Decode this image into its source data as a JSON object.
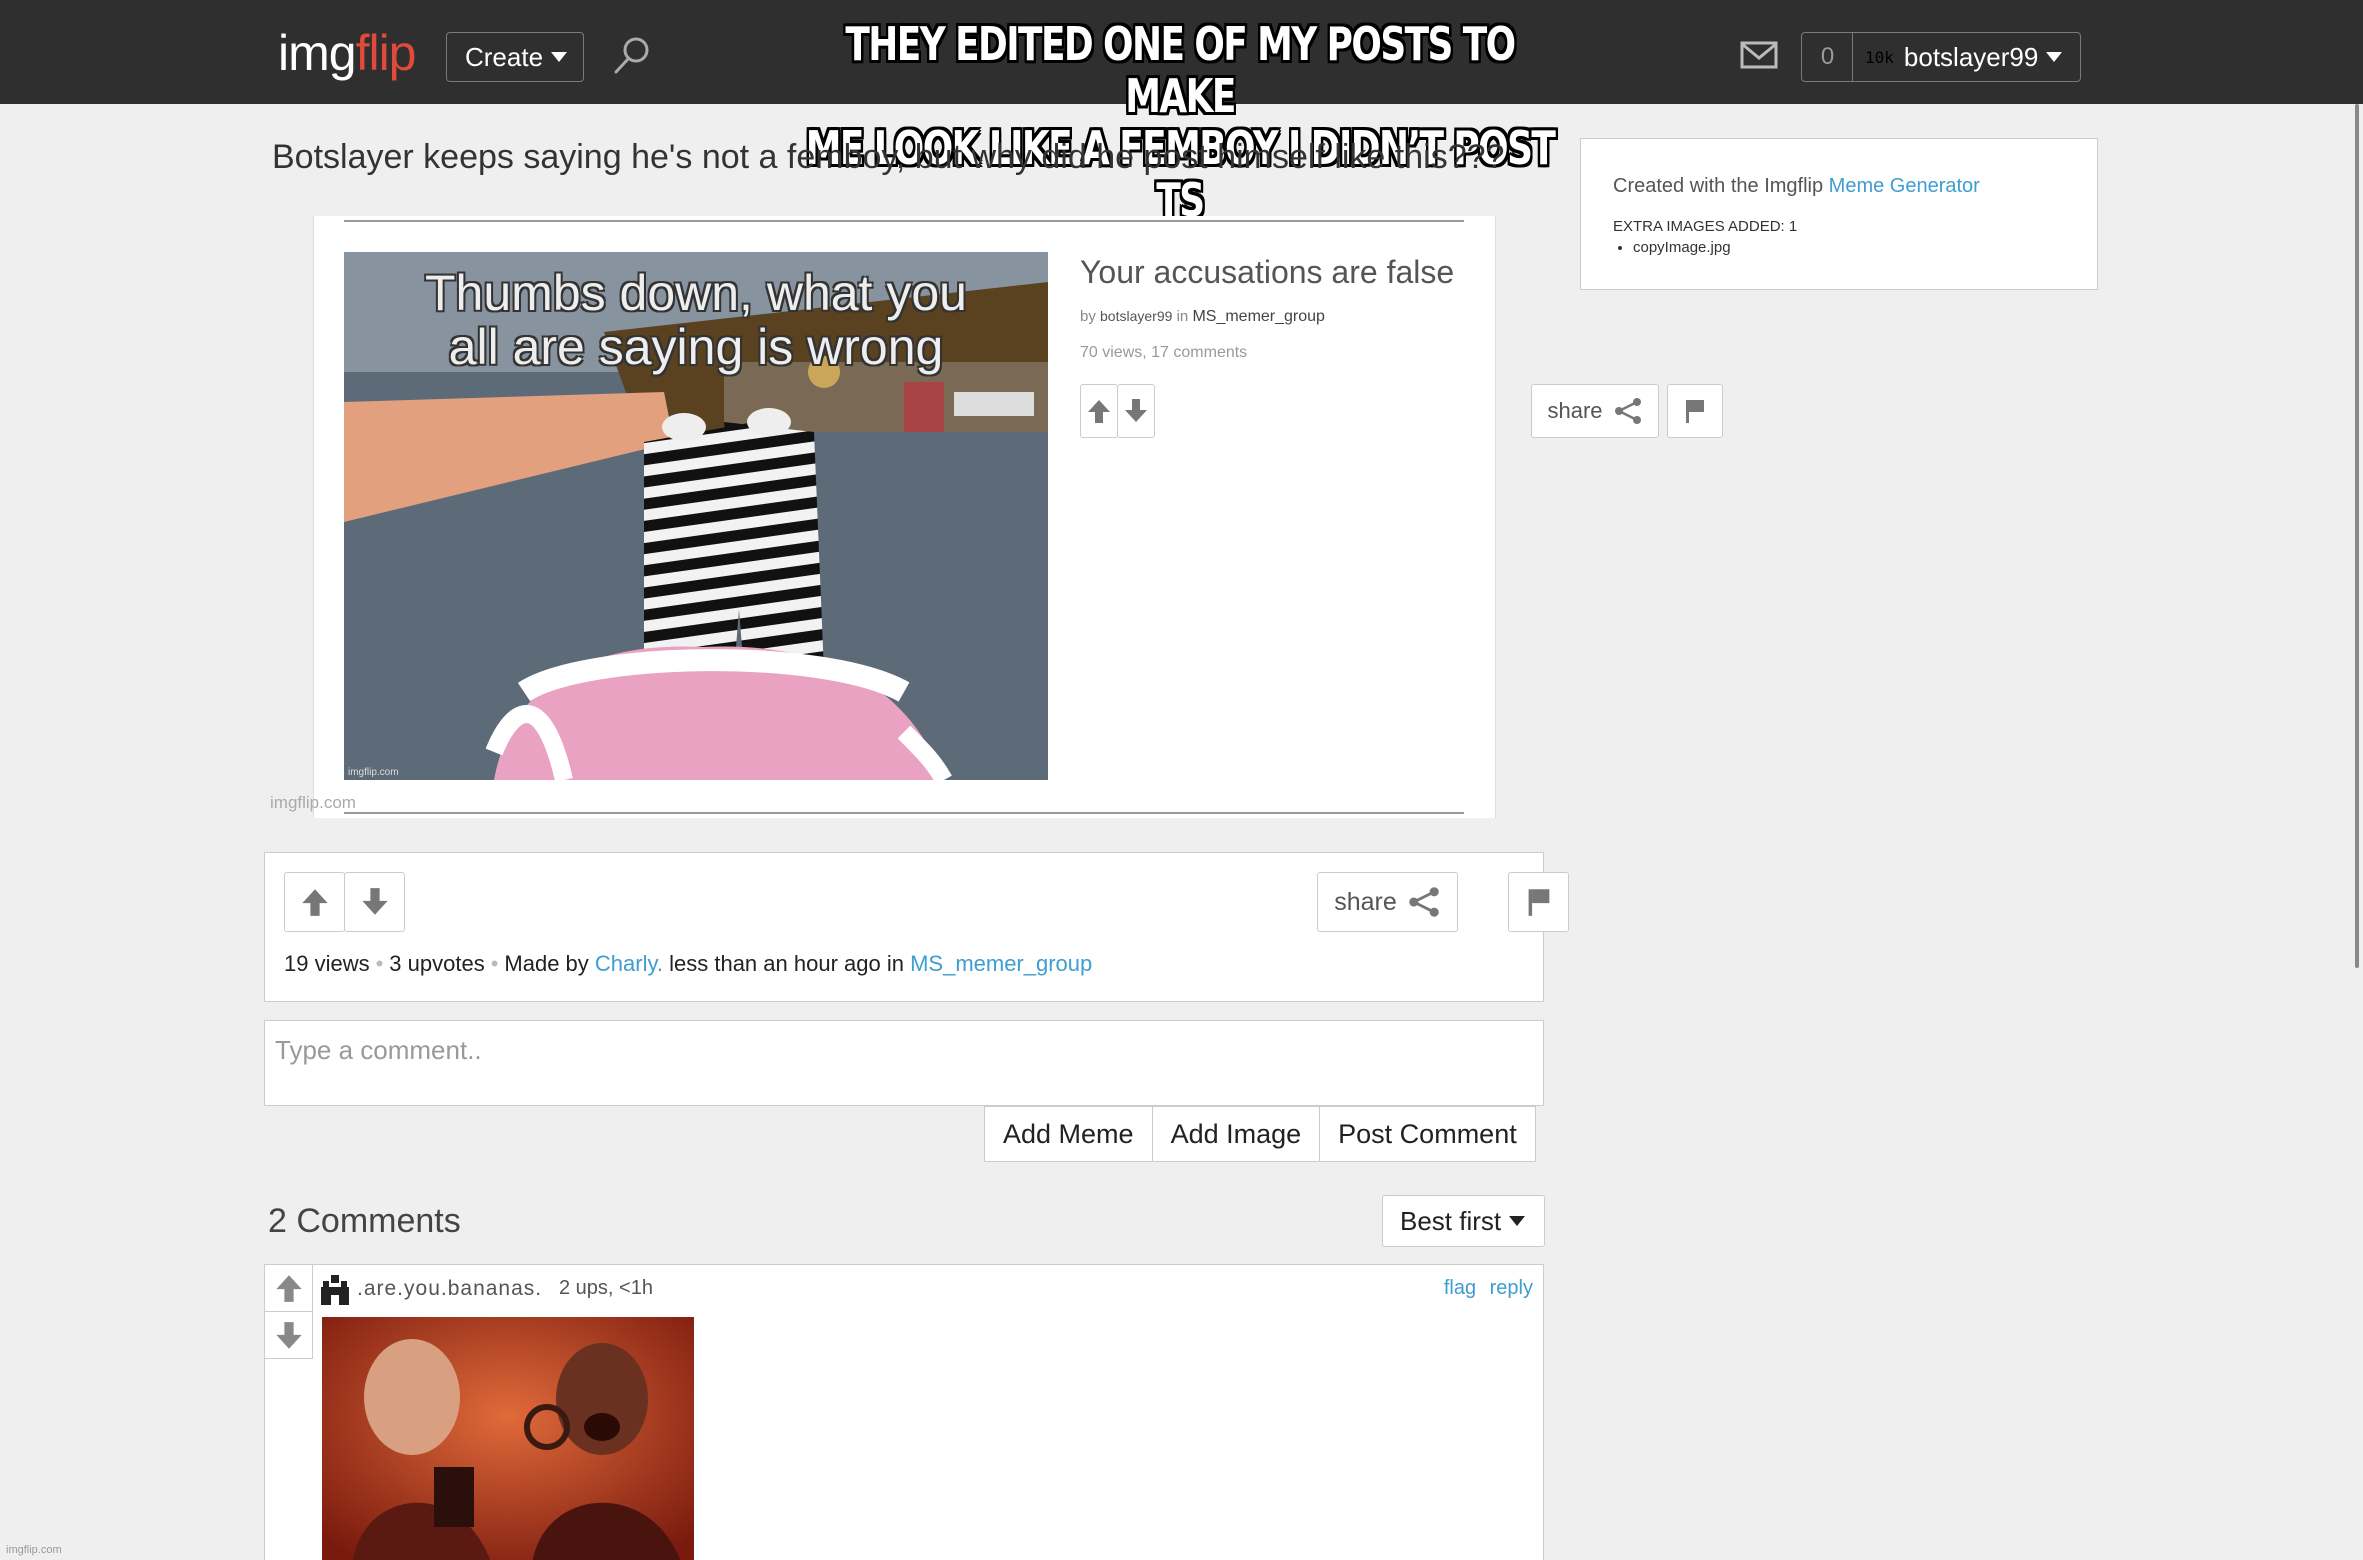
{
  "header": {
    "logo_prefix": "img",
    "logo_suffix": "flip",
    "create_label": "Create",
    "notification_count": "0",
    "points_label": "10k",
    "username": "botslayer99",
    "overlay_caption_line1": "THEY EDITED ONE OF MY POSTS TO MAKE",
    "overlay_caption_line2": "ME LOOK LIKE A FEMBOY  I DIDN’T POST TS"
  },
  "meme": {
    "title": "Botslayer keeps saying he's not a femboy, but why did he post himself like this???",
    "watermark": "imgflip.com",
    "inner": {
      "photo_caption_line1": "Thumbs down, what you",
      "photo_caption_line2": "all are saying is wrong",
      "photo_watermark": "imgflip.com",
      "title": "Your accusations are false",
      "by_prefix": "by",
      "by_user": "botslayer99",
      "in_word": "in",
      "group": "MS_memer_group",
      "stats": "70 views, 17 comments",
      "share_label": "share"
    }
  },
  "sidebar": {
    "created_text": "Created with the Imgflip",
    "created_link": "Meme Generator",
    "extra_label": "EXTRA IMAGES ADDED: 1",
    "extra_items": [
      "copyImage.jpg"
    ]
  },
  "actions": {
    "share_label": "share",
    "views": "19 views",
    "upvotes": "3 upvotes",
    "made_by": "Made by",
    "author": "Charly.",
    "time_text": "less than an hour ago in",
    "group": "MS_memer_group"
  },
  "comment_form": {
    "placeholder": "Type a comment..",
    "add_meme": "Add Meme",
    "add_image": "Add Image",
    "post_comment": "Post Comment"
  },
  "comments": {
    "heading": "2 Comments",
    "sort_label": "Best first",
    "items": [
      {
        "username": ".are.you.bananas.",
        "meta": "2 ups, <1h",
        "flag": "flag",
        "reply": "reply"
      }
    ]
  },
  "footer": {
    "watermark": "imgflip.com"
  },
  "colors": {
    "topbar": "#2f2f2f",
    "link": "#3e9dd1",
    "logo_accent": "#e04a3a"
  }
}
